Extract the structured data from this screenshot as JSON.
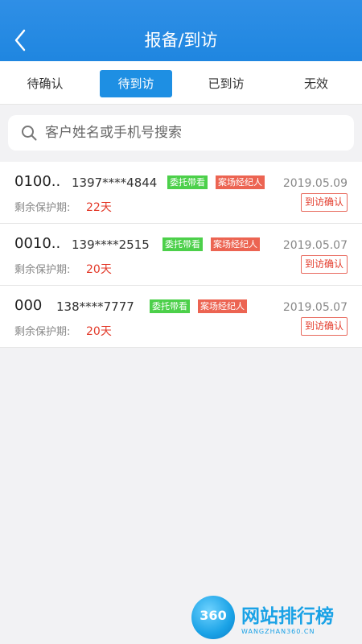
{
  "header": {
    "title": "报备/到访"
  },
  "tabs": [
    {
      "label": "待确认"
    },
    {
      "label": "待到访"
    },
    {
      "label": "已到访"
    },
    {
      "label": "无效"
    }
  ],
  "search": {
    "placeholder": "客户姓名或手机号搜索"
  },
  "records": [
    {
      "name": "0100..",
      "phone": "1397****4844",
      "badge_commission": "委托带看",
      "badge_agent": "案场经纪人",
      "date": "2019.05.09",
      "protection_label": "剩余保护期:",
      "protection_value": "22天",
      "confirm_label": "到访确认"
    },
    {
      "name": "0010..",
      "phone": "139****2515",
      "badge_commission": "委托带看",
      "badge_agent": "案场经纪人",
      "date": "2019.05.07",
      "protection_label": "剩余保护期:",
      "protection_value": "20天",
      "confirm_label": "到访确认"
    },
    {
      "name": "000",
      "phone": "138****7777",
      "badge_commission": "委托带看",
      "badge_agent": "案场经纪人",
      "date": "2019.05.07",
      "protection_label": "剩余保护期:",
      "protection_value": "20天",
      "confirm_label": "到访确认"
    }
  ],
  "watermark": {
    "number": "360",
    "text_cn": "网站排行榜",
    "text_en": "WANGZHAN360.CN"
  }
}
